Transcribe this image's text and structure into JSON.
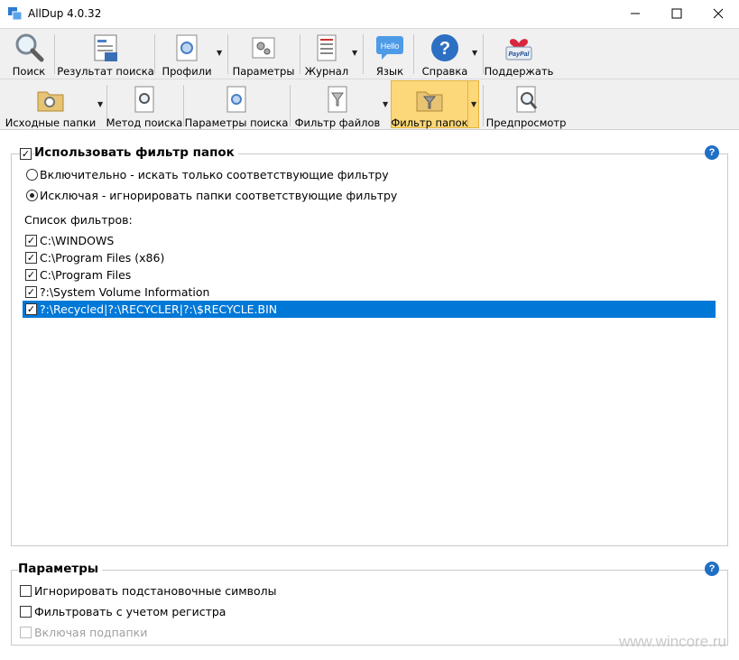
{
  "window": {
    "title": "AllDup 4.0.32"
  },
  "toolbar_main": [
    {
      "name": "search",
      "label": "Поиск"
    },
    {
      "name": "search-result",
      "label": "Результат поиска"
    },
    {
      "name": "profiles",
      "label": "Профили"
    },
    {
      "name": "parameters",
      "label": "Параметры"
    },
    {
      "name": "journal",
      "label": "Журнал"
    },
    {
      "name": "language",
      "label": "Язык"
    },
    {
      "name": "help",
      "label": "Справка"
    },
    {
      "name": "support",
      "label": "Поддержать"
    }
  ],
  "toolbar_sub": [
    {
      "name": "source-folders",
      "label": "Исходные папки"
    },
    {
      "name": "search-method",
      "label": "Метод поиска"
    },
    {
      "name": "search-parameters",
      "label": "Параметры поиска"
    },
    {
      "name": "file-filter",
      "label": "Фильтр файлов"
    },
    {
      "name": "folder-filter",
      "label": "Фильтр папок",
      "active": true
    },
    {
      "name": "preview",
      "label": "Предпросмотр"
    }
  ],
  "icons": {
    "language_icon_text": "Hello",
    "support_icon_text": "PayPal"
  },
  "folder_filter": {
    "title": "Использовать фильтр папок",
    "enabled": true,
    "mode_inclusive": "Включительно - искать только соответствующие фильтру",
    "mode_exclusive": "Исключая - игнорировать папки соответствующие фильтру",
    "selected_mode": "exclusive",
    "list_label": "Список фильтров:",
    "filters": [
      {
        "path": "C:\\WINDOWS",
        "checked": true,
        "selected": false
      },
      {
        "path": "C:\\Program Files (x86)",
        "checked": true,
        "selected": false
      },
      {
        "path": "C:\\Program Files",
        "checked": true,
        "selected": false
      },
      {
        "path": "?:\\System Volume Information",
        "checked": true,
        "selected": false
      },
      {
        "path": "?:\\Recycled|?:\\RECYCLER|?:\\$RECYCLE.BIN",
        "checked": true,
        "selected": true
      }
    ]
  },
  "params": {
    "title": "Параметры",
    "ignore_wildcards": "Игнорировать подстановочные символы",
    "case_sensitive": "Фильтровать с учетом регистра",
    "include_subfolders": "Включая подпапки"
  },
  "help_glyph": "?",
  "watermark": "www.wincore.ru",
  "colors": {
    "selection": "#0078d7",
    "active_tool": "#fcd87a",
    "help_icon": "#1f6fc5"
  }
}
